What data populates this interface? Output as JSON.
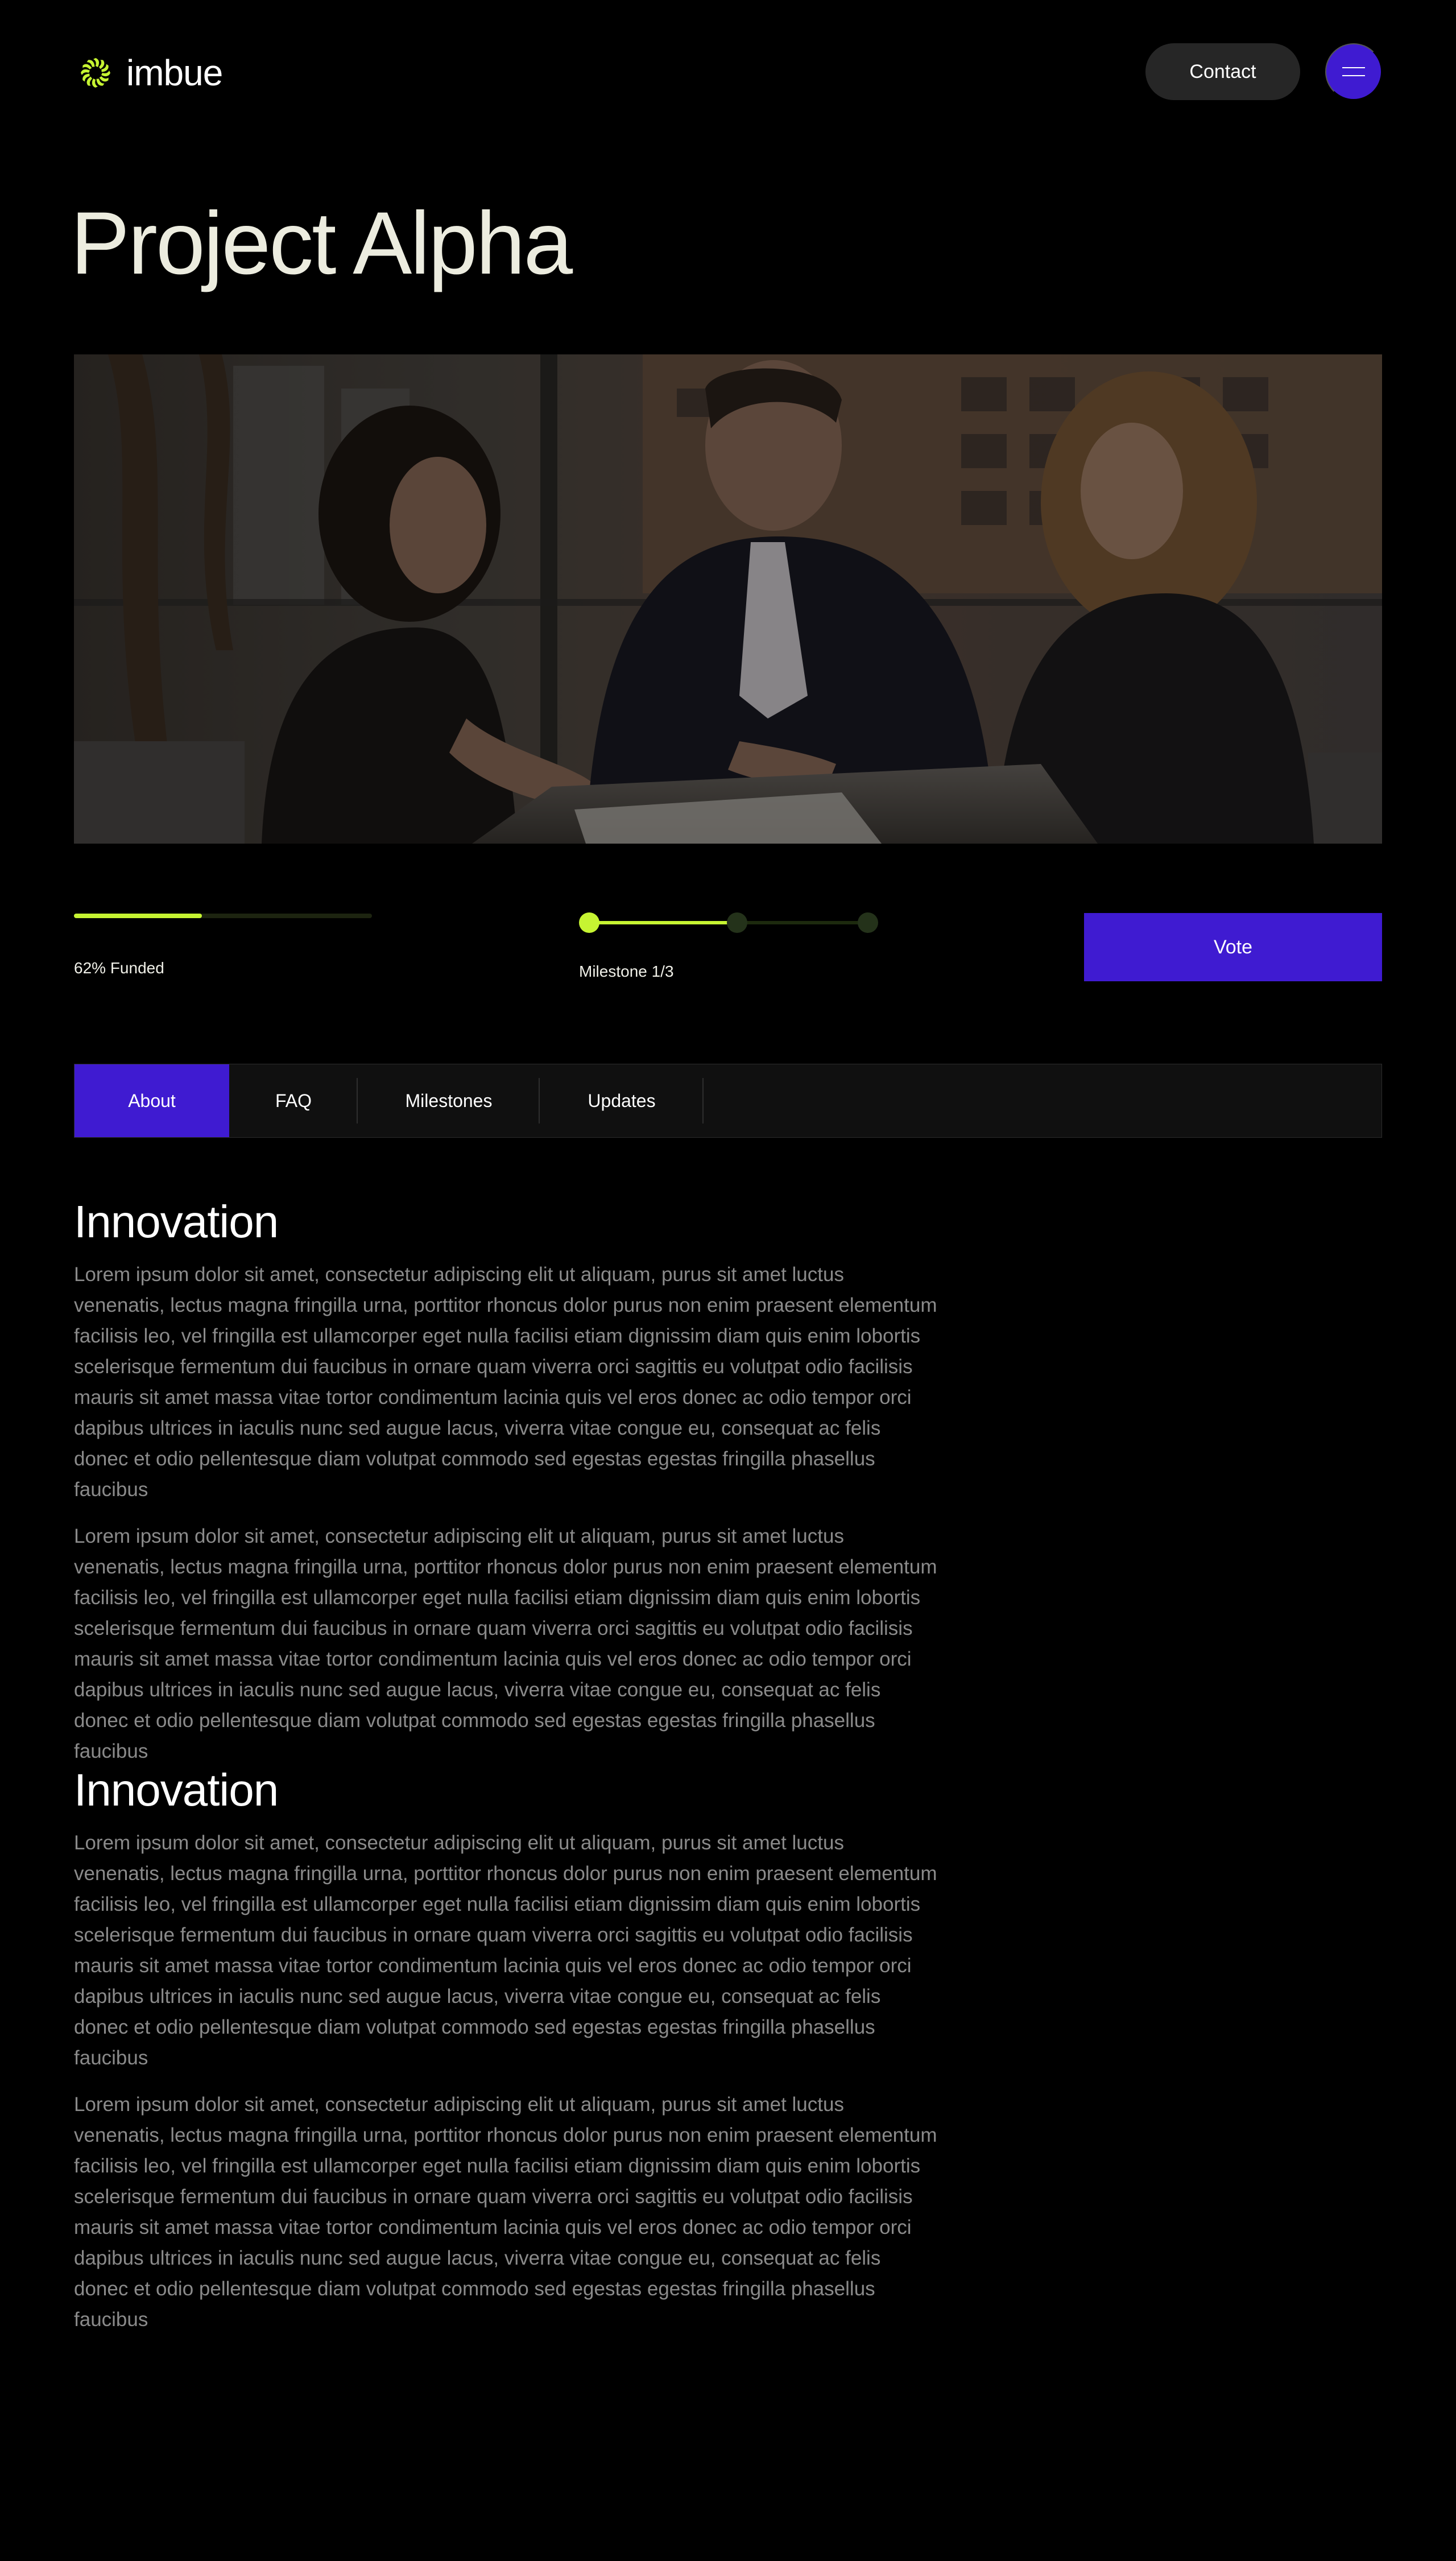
{
  "brand": {
    "name": "imbue",
    "accent": "#c6f432",
    "primary": "#3f1bd1",
    "logo_icon": "sunburst-logo-icon"
  },
  "header": {
    "contact_label": "Contact",
    "menu_icon": "hamburger-menu-icon"
  },
  "project": {
    "title": "Project Alpha"
  },
  "hero_image": {
    "subject": "three-people-meeting-photo"
  },
  "stats": {
    "funded_fraction": 0.43,
    "funded_label": "62% Funded",
    "milestone_current": 1,
    "milestone_total": 3,
    "milestone_label": "Milestone 1/3",
    "vote_label": "Vote"
  },
  "tabs": [
    {
      "label": "About",
      "active": true
    },
    {
      "label": "FAQ",
      "active": false
    },
    {
      "label": "Milestones",
      "active": false
    },
    {
      "label": "Updates",
      "active": false
    }
  ],
  "sections": [
    {
      "heading": "Innovation",
      "paragraphs": [
        "Lorem ipsum dolor sit amet, consectetur adipiscing elit ut aliquam, purus sit amet luctus venenatis, lectus magna fringilla urna, porttitor rhoncus dolor purus non enim praesent elementum facilisis leo, vel fringilla est ullamcorper eget nulla facilisi etiam dignissim diam quis enim lobortis scelerisque fermentum dui faucibus in ornare quam viverra orci sagittis eu volutpat odio facilisis mauris sit amet massa vitae tortor condimentum lacinia quis vel eros donec ac odio tempor orci dapibus ultrices in iaculis nunc sed augue lacus, viverra vitae congue eu, consequat ac felis donec et odio pellentesque diam volutpat commodo sed egestas egestas fringilla phasellus faucibus",
        "Lorem ipsum dolor sit amet, consectetur adipiscing elit ut aliquam, purus sit amet luctus venenatis, lectus magna fringilla urna, porttitor rhoncus dolor purus non enim praesent elementum facilisis leo, vel fringilla est ullamcorper eget nulla facilisi etiam dignissim diam quis enim lobortis scelerisque fermentum dui faucibus in ornare quam viverra orci sagittis eu volutpat odio facilisis mauris sit amet massa vitae tortor condimentum lacinia quis vel eros donec ac odio tempor orci dapibus ultrices in iaculis nunc sed augue lacus, viverra vitae congue eu, consequat ac felis donec et odio pellentesque diam volutpat commodo sed egestas egestas fringilla phasellus faucibus"
      ]
    },
    {
      "heading": "Innovation",
      "paragraphs": [
        "Lorem ipsum dolor sit amet, consectetur adipiscing elit ut aliquam, purus sit amet luctus venenatis, lectus magna fringilla urna, porttitor rhoncus dolor purus non enim praesent elementum facilisis leo, vel fringilla est ullamcorper eget nulla facilisi etiam dignissim diam quis enim lobortis scelerisque fermentum dui faucibus in ornare quam viverra orci sagittis eu volutpat odio facilisis mauris sit amet massa vitae tortor condimentum lacinia quis vel eros donec ac odio tempor orci dapibus ultrices in iaculis nunc sed augue lacus, viverra vitae congue eu, consequat ac felis donec et odio pellentesque diam volutpat commodo sed egestas egestas fringilla phasellus faucibus",
        "Lorem ipsum dolor sit amet, consectetur adipiscing elit ut aliquam, purus sit amet luctus venenatis, lectus magna fringilla urna, porttitor rhoncus dolor purus non enim praesent elementum facilisis leo, vel fringilla est ullamcorper eget nulla facilisi etiam dignissim diam quis enim lobortis scelerisque fermentum dui faucibus in ornare quam viverra orci sagittis eu volutpat odio facilisis mauris sit amet massa vitae tortor condimentum lacinia quis vel eros donec ac odio tempor orci dapibus ultrices in iaculis nunc sed augue lacus, viverra vitae congue eu, consequat ac felis donec et odio pellentesque diam volutpat commodo sed egestas egestas fringilla phasellus faucibus"
      ]
    }
  ]
}
